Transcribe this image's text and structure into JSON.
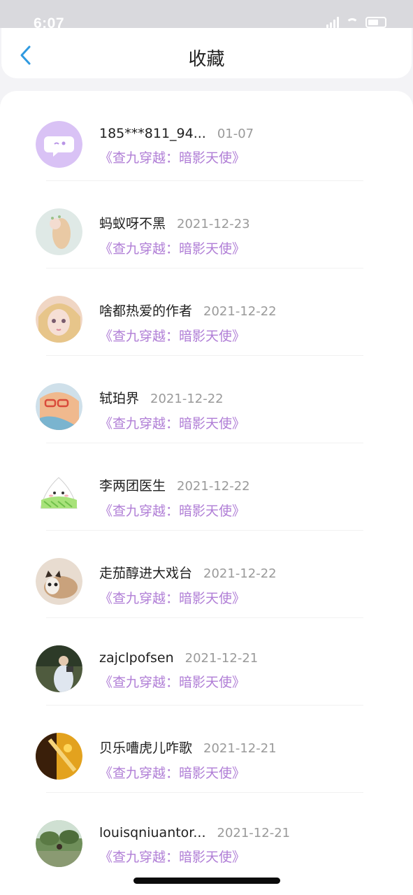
{
  "status": {
    "time": "6:07"
  },
  "header": {
    "title": "收藏"
  },
  "items": [
    {
      "name": "185***811_94...",
      "date": "01-07",
      "work": "《查九穿越：暗影天使》"
    },
    {
      "name": "蚂蚁呀不黑",
      "date": "2021-12-23",
      "work": "《查九穿越：暗影天使》"
    },
    {
      "name": "啥都热爱的作者",
      "date": "2021-12-22",
      "work": "《查九穿越：暗影天使》"
    },
    {
      "name": "轼珀界",
      "date": "2021-12-22",
      "work": "《查九穿越：暗影天使》"
    },
    {
      "name": "李两团医生",
      "date": "2021-12-22",
      "work": "《查九穿越：暗影天使》"
    },
    {
      "name": "走茄醇进大戏台",
      "date": "2021-12-22",
      "work": "《查九穿越：暗影天使》"
    },
    {
      "name": "zajclpofsen",
      "date": "2021-12-21",
      "work": "《查九穿越：暗影天使》"
    },
    {
      "name": "贝乐嘈虎儿咋歌",
      "date": "2021-12-21",
      "work": "《查九穿越：暗影天使》"
    },
    {
      "name": "louisqniuantor...",
      "date": "2021-12-21",
      "work": "《查九穿越：暗影天使》"
    }
  ],
  "colors": {
    "accent": "#2f9ae0",
    "work_title": "#b07ed6"
  }
}
